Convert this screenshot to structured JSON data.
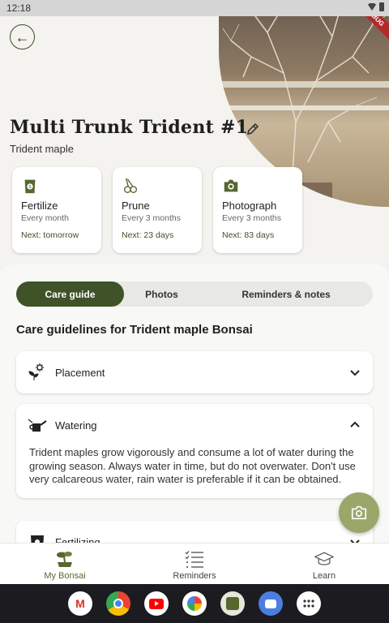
{
  "status_bar": {
    "time": "12:18"
  },
  "debug_banner": "DEBUG",
  "plant": {
    "name": "Multi Trunk Trident #1",
    "species": "Trident maple"
  },
  "tasks": [
    {
      "icon": "fertilizer-bag-icon",
      "title": "Fertilize",
      "frequency": "Every month",
      "next": "Next: tomorrow"
    },
    {
      "icon": "pruning-shears-icon",
      "title": "Prune",
      "frequency": "Every 3 months",
      "next": "Next: 23 days"
    },
    {
      "icon": "camera-icon",
      "title": "Photograph",
      "frequency": "Every 3 months",
      "next": "Next: 83 days"
    }
  ],
  "tabs": [
    {
      "label": "Care guide",
      "active": true
    },
    {
      "label": "Photos",
      "active": false
    },
    {
      "label": "Reminders & notes",
      "active": false
    }
  ],
  "care": {
    "heading": "Care guidelines for Trident maple Bonsai",
    "sections": [
      {
        "icon": "placement-icon",
        "label": "Placement",
        "expanded": false
      },
      {
        "icon": "watering-can-icon",
        "label": "Watering",
        "expanded": true,
        "body": "Trident maples grow vigorously and consume a lot of water during the growing season. Always water in time, but do not overwater. Don't use very calcareous water, rain water is preferable if it can be obtained."
      },
      {
        "icon": "fertilizer-icon",
        "label": "Fertilizing",
        "expanded": false
      }
    ]
  },
  "bottom_nav": [
    {
      "icon": "bonsai-icon",
      "label": "My Bonsai",
      "active": true
    },
    {
      "icon": "checklist-icon",
      "label": "Reminders",
      "active": false
    },
    {
      "icon": "graduation-cap-icon",
      "label": "Learn",
      "active": false
    }
  ],
  "dock_apps": [
    "gmail",
    "chrome",
    "youtube",
    "photos",
    "files",
    "messages",
    "app-drawer"
  ],
  "colors": {
    "accent": "#3f5228",
    "fab": "#9aa76a",
    "background": "#f4f3ef"
  }
}
